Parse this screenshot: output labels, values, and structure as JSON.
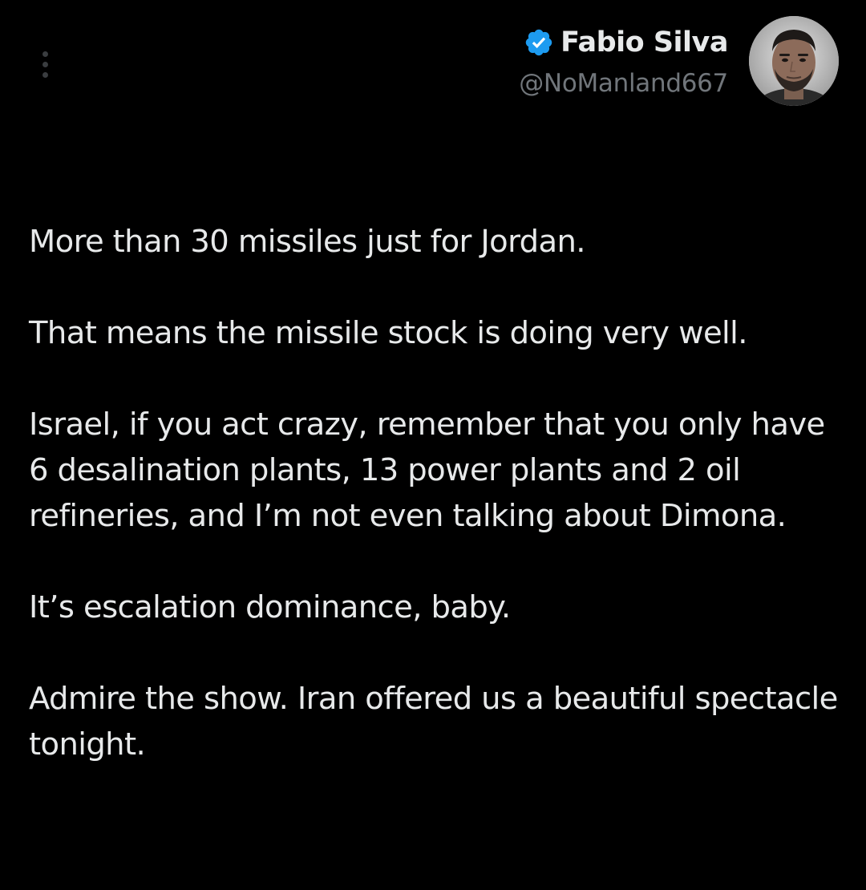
{
  "tweet": {
    "author": {
      "display_name": "Fabio Silva",
      "handle": "@NoManland667",
      "verified": true,
      "verified_icon": "verified-badge-icon",
      "verified_color": "#1d9bf0"
    },
    "menu_icon": "more-vertical-icon",
    "paragraphs": [
      "More than 30 missiles just for Jordan.",
      "That means the missile stock is doing very well.",
      "Israel, if you act crazy, remember that you only have 6 desalination plants, 13 power plants and 2 oil refineries, and I’m not even talking about Dimona.",
      "It’s escalation dominance, baby.",
      "Admire the show. Iran offered us a beautiful spectacle tonight."
    ]
  },
  "colors": {
    "background": "#000000",
    "primary_text": "#e7e9ea",
    "secondary_text": "#71767b"
  }
}
